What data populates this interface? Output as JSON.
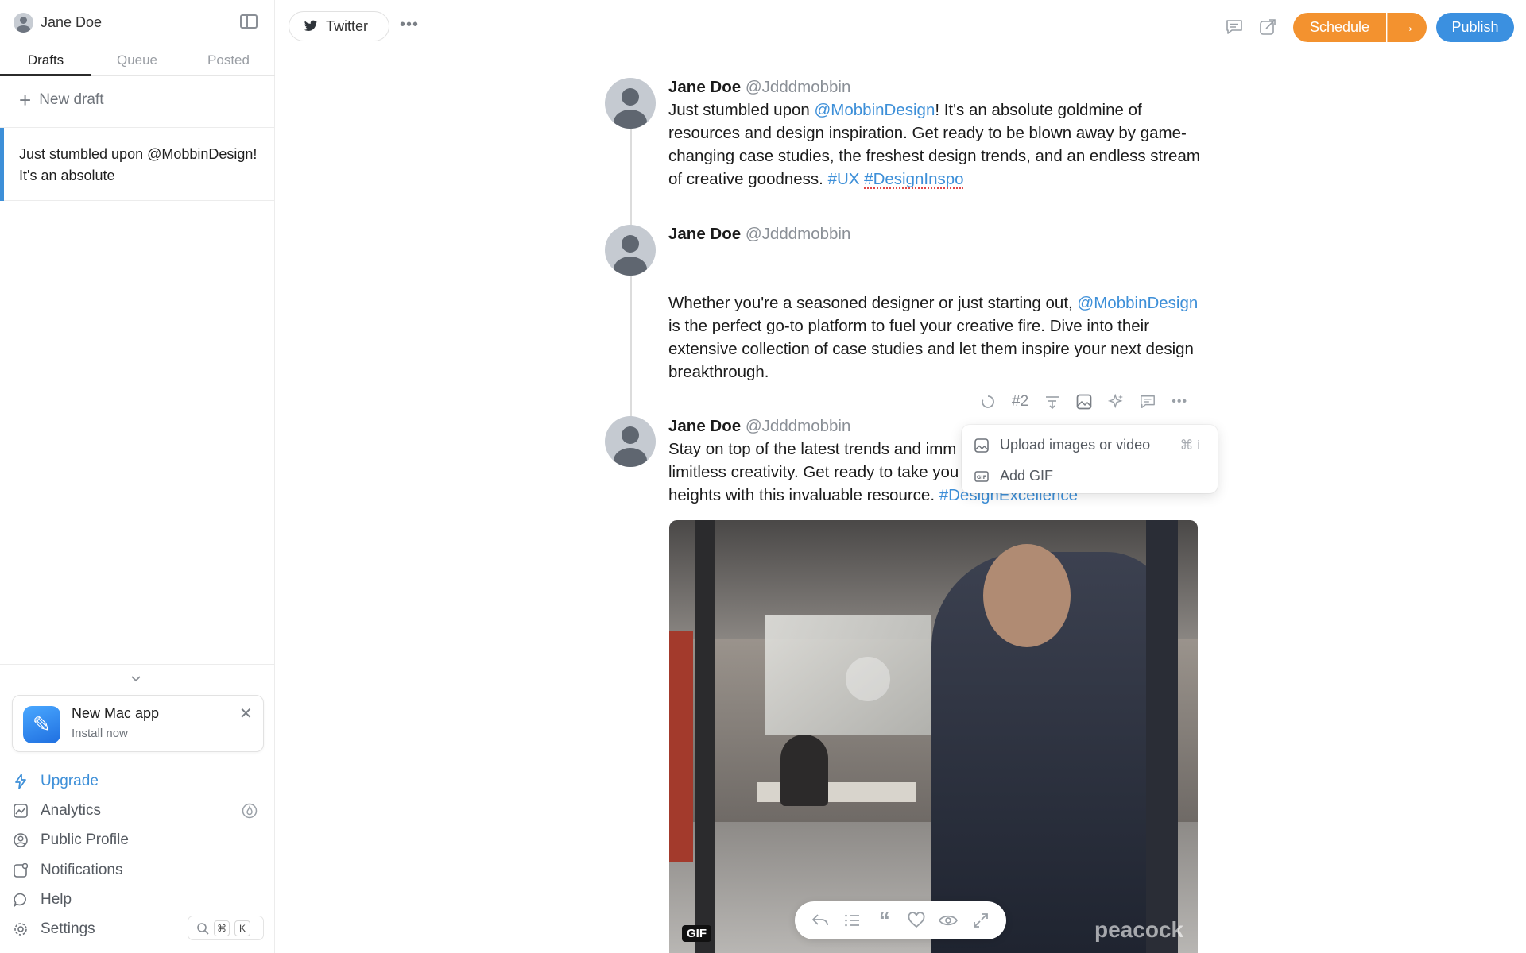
{
  "sidebar": {
    "user_name": "Jane Doe",
    "tabs": [
      {
        "label": "Drafts",
        "active": true
      },
      {
        "label": "Queue",
        "active": false
      },
      {
        "label": "Posted",
        "active": false
      }
    ],
    "new_draft_label": "New draft",
    "drafts": [
      {
        "preview": "Just stumbled upon @MobbinDesign! It's an absolute"
      }
    ],
    "promo": {
      "title": "New Mac app",
      "subtitle": "Install now"
    },
    "nav": [
      {
        "label": "Upgrade",
        "icon": "lightning-icon"
      },
      {
        "label": "Analytics",
        "icon": "chart-icon"
      },
      {
        "label": "Public Profile",
        "icon": "user-circle-icon"
      },
      {
        "label": "Notifications",
        "icon": "bell-icon"
      },
      {
        "label": "Help",
        "icon": "chat-bubble-icon"
      },
      {
        "label": "Settings",
        "icon": "gear-icon"
      }
    ],
    "shortcut": {
      "key1": "⌘",
      "key2": "K"
    }
  },
  "topbar": {
    "account_label": "Twitter",
    "schedule_label": "Schedule",
    "publish_label": "Publish"
  },
  "thread": [
    {
      "name": "Jane Doe",
      "handle": "@Jdddmobbin",
      "text_before": "Just stumbled upon ",
      "mention": "@MobbinDesign",
      "text_after": "! It's an absolute goldmine of resources and design inspiration. Get ready to be blown away by game-changing case studies, the freshest design trends, and an endless stream of creative goodness. ",
      "tag1": "#UX",
      "tag2": "#DesignInspo"
    },
    {
      "name": "Jane Doe",
      "handle": "@Jdddmobbin",
      "text_before": "Whether you're a seasoned designer or just starting out, ",
      "mention": "@MobbinDesign",
      "text_after": " is the perfect go-to platform to fuel your creative fire. Dive into their extensive collection of case studies and let them inspire your next design breakthrough."
    },
    {
      "name": "Jane Doe",
      "handle": "@Jdddmobbin",
      "text_before": "Stay on top of the latest trends and imm",
      "line2": "limitless creativity. Get ready to take you",
      "line3": "heights with this invaluable resource. ",
      "tag": "#DesignExcellence"
    }
  ],
  "post_toolbar": {
    "number": "#2"
  },
  "dropdown": {
    "items": [
      {
        "label": "Upload images or video",
        "shortcut": "⌘ i"
      },
      {
        "label": "Add GIF",
        "shortcut": ""
      }
    ]
  },
  "gif": {
    "badge": "GIF",
    "watermark": "peacock"
  },
  "colors": {
    "accent_blue": "#3d8fd8",
    "schedule_orange": "#f3922f",
    "publish_blue": "#3b90e0"
  }
}
